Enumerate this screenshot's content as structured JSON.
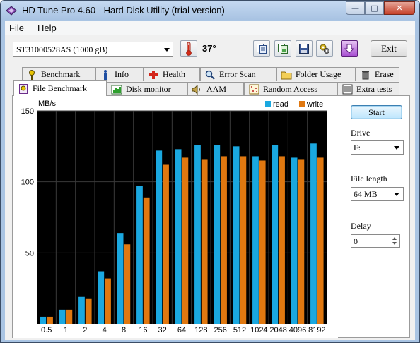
{
  "window": {
    "title": "HD Tune Pro 4.60 - Hard Disk Utility (trial version)"
  },
  "menu": {
    "file": "File",
    "help": "Help"
  },
  "toolbar": {
    "drive": "ST31000528AS (1000 gB)",
    "temperature": "37°",
    "exit_label": "Exit"
  },
  "tabs_top": [
    {
      "label": "Benchmark",
      "icon": "gauge-icon"
    },
    {
      "label": "Info",
      "icon": "info-icon"
    },
    {
      "label": "Health",
      "icon": "health-cross-icon"
    },
    {
      "label": "Error Scan",
      "icon": "magnifier-icon"
    },
    {
      "label": "Folder Usage",
      "icon": "folder-icon"
    },
    {
      "label": "Erase",
      "icon": "trash-icon"
    }
  ],
  "tabs_bottom": [
    {
      "label": "File Benchmark",
      "icon": "file-benchmark-icon"
    },
    {
      "label": "Disk monitor",
      "icon": "monitor-chart-icon"
    },
    {
      "label": "AAM",
      "icon": "speaker-icon"
    },
    {
      "label": "Random Access",
      "icon": "random-access-icon"
    },
    {
      "label": "Extra tests",
      "icon": "extra-tests-icon"
    }
  ],
  "controls": {
    "start_label": "Start",
    "drive_label": "Drive",
    "drive_value": "F:",
    "file_length_label": "File length",
    "file_length_value": "64 MB",
    "delay_label": "Delay",
    "delay_value": "0"
  },
  "colors": {
    "read": "#1aa8e0",
    "write": "#e07810",
    "plot_bg": "#000000",
    "grid": "#3a3a3a"
  },
  "chart_data": {
    "type": "bar",
    "ylabel": "MB/s",
    "ylim": [
      0,
      150
    ],
    "yticks": [
      50,
      100,
      150
    ],
    "categories": [
      "0.5",
      "1",
      "2",
      "4",
      "8",
      "16",
      "32",
      "64",
      "128",
      "256",
      "512",
      "1024",
      "2048",
      "4096",
      "8192"
    ],
    "series": [
      {
        "name": "read",
        "values": [
          5,
          10,
          19,
          37,
          64,
          97,
          122,
          123,
          126,
          126,
          125,
          118,
          126,
          117,
          127
        ]
      },
      {
        "name": "write",
        "values": [
          5,
          10,
          18,
          32,
          56,
          89,
          112,
          117,
          116,
          118,
          118,
          115,
          118,
          116,
          117
        ]
      }
    ],
    "legend": "top-right",
    "grid": true
  }
}
